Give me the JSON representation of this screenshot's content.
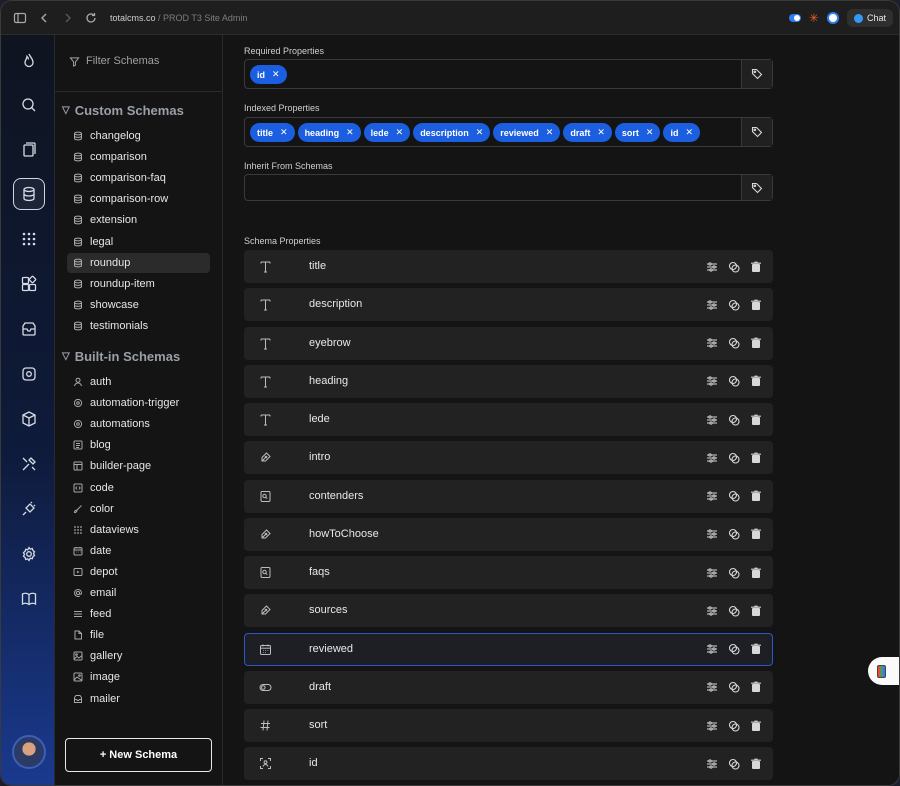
{
  "browser": {
    "url_host": "totalcms.co",
    "url_rest": " / PROD T3 Site Admin",
    "chat_label": "Chat"
  },
  "rail": {
    "icons": [
      "flame-icon",
      "search-icon",
      "pages-icon",
      "database-icon",
      "grid-dots-icon",
      "widgets-icon",
      "inbox-icon",
      "automation-icon",
      "package-icon",
      "tools-icon",
      "plug-icon",
      "settings-icon",
      "book-icon"
    ],
    "active": "database-icon"
  },
  "sidebar": {
    "filter_placeholder": "Filter Schemas",
    "custom_title": "Custom Schemas",
    "custom_items": [
      {
        "label": "changelog"
      },
      {
        "label": "comparison"
      },
      {
        "label": "comparison-faq"
      },
      {
        "label": "comparison-row"
      },
      {
        "label": "extension"
      },
      {
        "label": "legal"
      },
      {
        "label": "roundup"
      },
      {
        "label": "roundup-item"
      },
      {
        "label": "showcase"
      },
      {
        "label": "testimonials"
      }
    ],
    "active_item": "roundup",
    "builtin_title": "Built-in Schemas",
    "builtin_items": [
      {
        "label": "auth",
        "icon": "user-icon"
      },
      {
        "label": "automation-trigger",
        "icon": "gear-icon"
      },
      {
        "label": "automations",
        "icon": "gear-icon"
      },
      {
        "label": "blog",
        "icon": "blog-icon"
      },
      {
        "label": "builder-page",
        "icon": "page-icon"
      },
      {
        "label": "code",
        "icon": "code-icon"
      },
      {
        "label": "color",
        "icon": "brush-icon"
      },
      {
        "label": "dataviews",
        "icon": "grid-dots-icon"
      },
      {
        "label": "date",
        "icon": "calendar-icon"
      },
      {
        "label": "depot",
        "icon": "folder-icon"
      },
      {
        "label": "email",
        "icon": "at-icon"
      },
      {
        "label": "feed",
        "icon": "feed-icon"
      },
      {
        "label": "file",
        "icon": "file-icon"
      },
      {
        "label": "gallery",
        "icon": "gallery-icon"
      },
      {
        "label": "image",
        "icon": "image-icon"
      },
      {
        "label": "mailer",
        "icon": "inbox-icon"
      }
    ],
    "new_schema_label": "+ New Schema"
  },
  "main": {
    "required_label": "Required Properties",
    "required_tags": [
      "id"
    ],
    "indexed_label": "Indexed Properties",
    "indexed_tags": [
      "title",
      "heading",
      "lede",
      "description",
      "reviewed",
      "draft",
      "sort",
      "id"
    ],
    "inherit_label": "Inherit From Schemas",
    "inherit_tags": [],
    "properties_label": "Schema Properties",
    "properties": [
      {
        "name": "title",
        "icon": "text-icon"
      },
      {
        "name": "description",
        "icon": "text-icon"
      },
      {
        "name": "eyebrow",
        "icon": "text-icon"
      },
      {
        "name": "heading",
        "icon": "text-icon"
      },
      {
        "name": "lede",
        "icon": "text-icon"
      },
      {
        "name": "intro",
        "icon": "pen-icon"
      },
      {
        "name": "contenders",
        "icon": "list-doc-icon"
      },
      {
        "name": "howToChoose",
        "icon": "pen-icon"
      },
      {
        "name": "faqs",
        "icon": "list-doc-icon"
      },
      {
        "name": "sources",
        "icon": "pen-icon"
      },
      {
        "name": "reviewed",
        "icon": "calendar-icon"
      },
      {
        "name": "draft",
        "icon": "toggle-icon"
      },
      {
        "name": "sort",
        "icon": "hash-icon"
      },
      {
        "name": "id",
        "icon": "id-scan-icon"
      }
    ],
    "selected_property": "reviewed"
  }
}
